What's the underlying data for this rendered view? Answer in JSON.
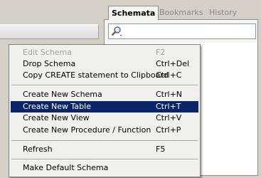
{
  "tabs": [
    {
      "label": "Schemata",
      "active": true
    },
    {
      "label": "Bookmarks",
      "active": false
    },
    {
      "label": "History",
      "active": false
    }
  ],
  "search": {
    "value": "",
    "placeholder": ""
  },
  "menu": {
    "items": [
      {
        "label": "Edit Schema",
        "shortcut": "F2",
        "state": "disabled"
      },
      {
        "label": "Drop Schema",
        "shortcut": "Ctrl+Del",
        "state": "normal"
      },
      {
        "label": "Copy CREATE statement to Clipboard",
        "shortcut": "Ctrl+C",
        "state": "normal"
      },
      {
        "label": "Create New Schema",
        "shortcut": "Ctrl+N",
        "state": "normal"
      },
      {
        "label": "Create New Table",
        "shortcut": "Ctrl+T",
        "state": "highlighted"
      },
      {
        "label": "Create New View",
        "shortcut": "Ctrl+V",
        "state": "normal"
      },
      {
        "label": "Create New Procedure / Function",
        "shortcut": "Ctrl+P",
        "state": "normal"
      },
      {
        "label": "Refresh",
        "shortcut": "F5",
        "state": "normal"
      },
      {
        "label": "Make Default Schema",
        "shortcut": "",
        "state": "normal"
      }
    ]
  },
  "icons": {
    "search": "magnifier-icon"
  },
  "colors": {
    "highlight": "#0a246a",
    "disabled_text": "#a0a0a0",
    "menu_bg": "#f0f0ec"
  }
}
